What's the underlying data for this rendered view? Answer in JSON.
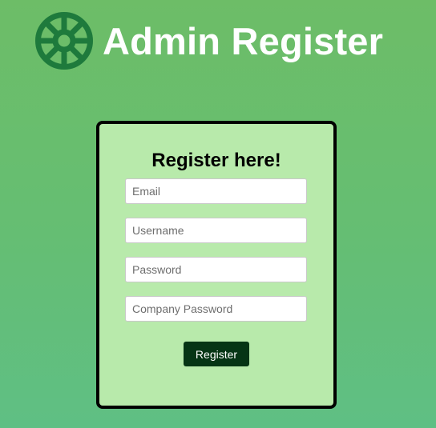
{
  "colors": {
    "logo": "#1e7a3c",
    "card_background": "#b8eaab",
    "button_background": "#063515"
  },
  "header": {
    "logo_icon": "ship-wheel-icon",
    "title": "Admin Register"
  },
  "form": {
    "title": "Register here!",
    "fields": [
      {
        "placeholder": "Email",
        "value": ""
      },
      {
        "placeholder": "Username",
        "value": ""
      },
      {
        "placeholder": "Password",
        "value": ""
      },
      {
        "placeholder": "Company Password",
        "value": ""
      }
    ],
    "submit_label": "Register"
  }
}
